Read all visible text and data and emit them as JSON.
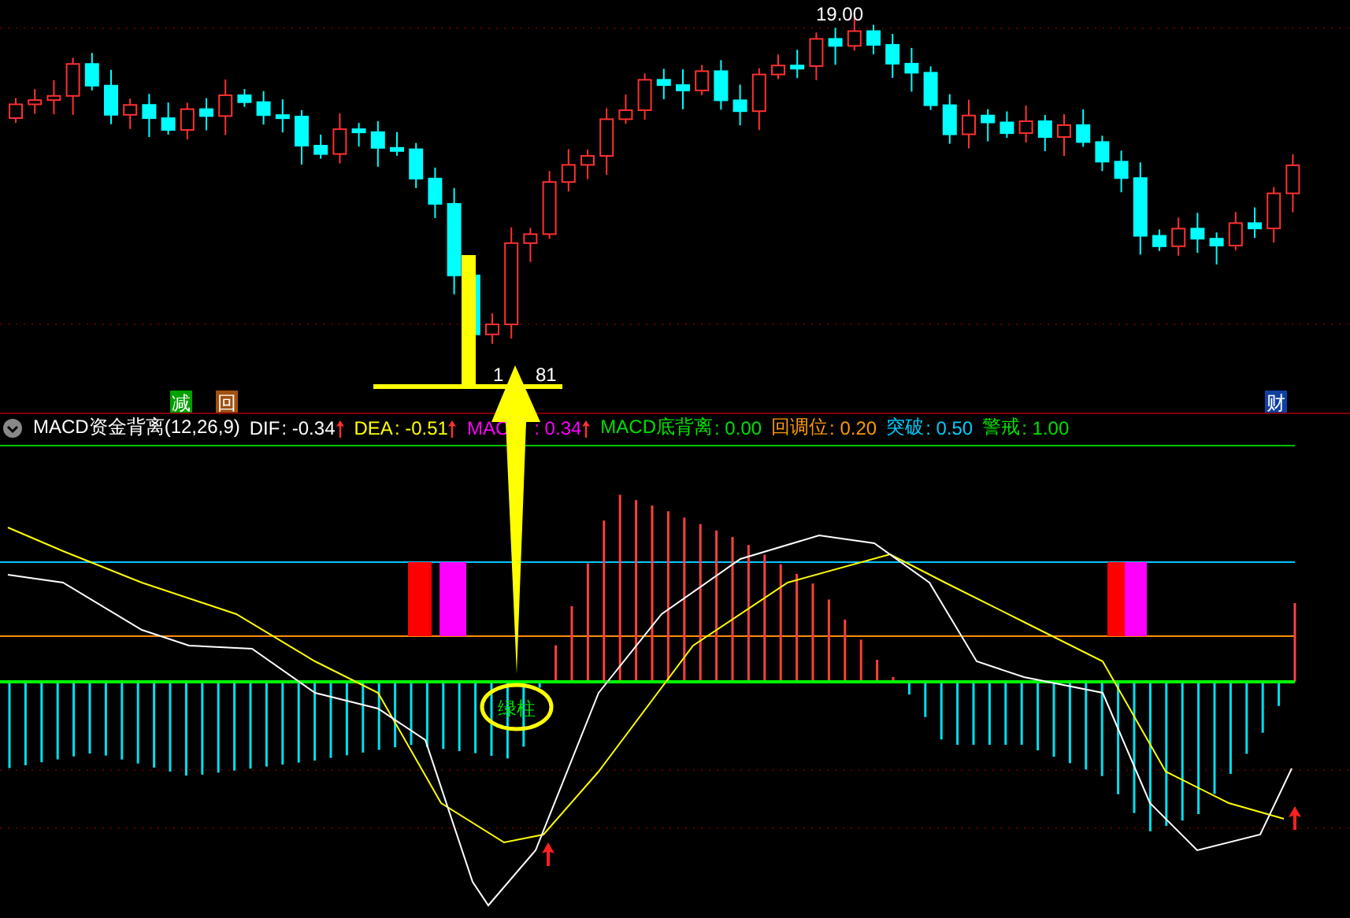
{
  "price_panel": {
    "high_label": "19.00",
    "low_label_parts": [
      "1",
      "81"
    ],
    "markers": [
      {
        "text": "减",
        "color": "#00a000"
      },
      {
        "text": "回",
        "color": "#a05010"
      },
      {
        "text": "财",
        "color": "#1040a0"
      }
    ]
  },
  "indicator": {
    "name": "MACD资金背离(12,26,9)",
    "values": [
      {
        "label": "DIF",
        "value": ": -0.34",
        "color": "#ffffff",
        "arrow": true
      },
      {
        "label": "DEA",
        "value": ": -0.51",
        "color": "#ffff00",
        "arrow": true
      },
      {
        "label": "MAC",
        "value": ": 0.34",
        "color": "#ff00ff",
        "arrow": true
      },
      {
        "label": "MACD底背离",
        "value": ": 0.00",
        "color": "#00e000"
      },
      {
        "label": "回调位",
        "value": ": 0.20",
        "color": "#ff9900"
      },
      {
        "label": "突破",
        "value": ": 0.50",
        "color": "#00ccff"
      },
      {
        "label": "警戒",
        "value": ": 1.00",
        "color": "#00e000"
      }
    ]
  },
  "macd_panel": {
    "circled_label": "绿柱"
  }
}
